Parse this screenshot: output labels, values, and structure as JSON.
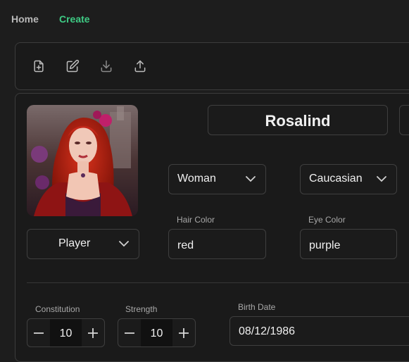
{
  "nav": {
    "home": "Home",
    "create": "Create"
  },
  "toolbar": {
    "icons": [
      "new-file-icon",
      "edit-icon",
      "download-icon",
      "upload-icon"
    ]
  },
  "character": {
    "name": "Rosalind",
    "role": "Player",
    "sex": "Woman",
    "race": "Caucasian",
    "hair_color_label": "Hair Color",
    "hair_color": "red",
    "eye_color_label": "Eye Color",
    "eye_color": "purple",
    "constitution_label": "Constitution",
    "constitution": "10",
    "strength_label": "Strength",
    "strength": "10",
    "birth_date_label": "Birth Date",
    "birth_date": "08/12/1986"
  },
  "colors": {
    "accent": "#3ecb84",
    "background": "#1d1d1d",
    "border": "#3c3c3c"
  }
}
